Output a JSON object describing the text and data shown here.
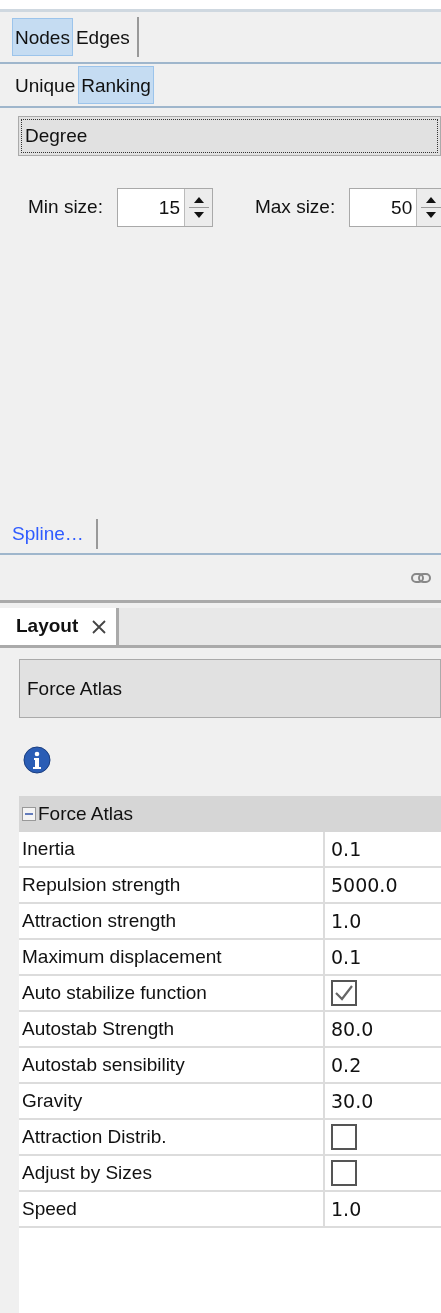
{
  "top_tabs": [
    {
      "label": "Nodes",
      "selected": true
    },
    {
      "label": "Edges",
      "selected": false
    }
  ],
  "mode_tabs": [
    {
      "label": "Unique",
      "selected": false
    },
    {
      "label": "Ranking",
      "selected": true
    }
  ],
  "ranking_parameter": {
    "value": "Degree"
  },
  "size_fields": [
    {
      "label": "Min size:",
      "value": "15"
    },
    {
      "label": "Max size:",
      "value": "50"
    }
  ],
  "spline_link": "Spline…",
  "layout_tab": {
    "label": "Layout",
    "selected": true
  },
  "algorithm": {
    "value": "Force Atlas"
  },
  "properties": {
    "group": "Force Atlas",
    "expanded": true,
    "rows": [
      {
        "name": "Inertia",
        "kind": "text",
        "value": "0.1"
      },
      {
        "name": "Repulsion strength",
        "kind": "text",
        "value": "5000.0"
      },
      {
        "name": "Attraction strength",
        "kind": "text",
        "value": "1.0"
      },
      {
        "name": "Maximum displacement",
        "kind": "text",
        "value": "0.1"
      },
      {
        "name": "Auto stabilize function",
        "kind": "checkbox",
        "checked": true
      },
      {
        "name": "Autostab Strength",
        "kind": "text",
        "value": "80.0"
      },
      {
        "name": "Autostab sensibility",
        "kind": "text",
        "value": "0.2"
      },
      {
        "name": "Gravity",
        "kind": "text",
        "value": "30.0"
      },
      {
        "name": "Attraction Distrib.",
        "kind": "checkbox",
        "checked": false
      },
      {
        "name": "Adjust by Sizes",
        "kind": "checkbox",
        "checked": false
      },
      {
        "name": "Speed",
        "kind": "text",
        "value": "1.0"
      }
    ]
  }
}
